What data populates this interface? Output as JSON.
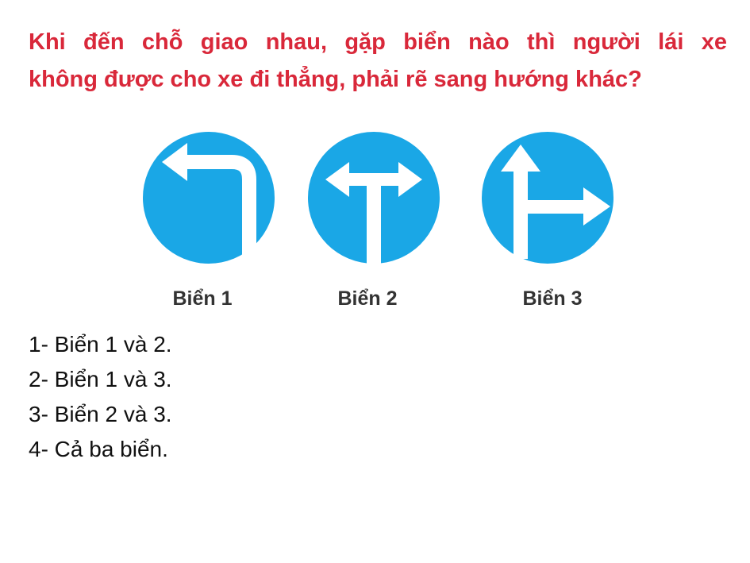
{
  "question": {
    "line1": "Khi đến chỗ giao nhau, gặp biển nào thì người lái xe",
    "line2": "không được cho xe đi thẳng, phải rẽ sang hướng khác?"
  },
  "signs": [
    {
      "label": "Biển 1",
      "icon": "turn-left-only-sign-icon"
    },
    {
      "label": "Biển 2",
      "icon": "turn-left-or-right-sign-icon"
    },
    {
      "label": "Biển 3",
      "icon": "straight-or-right-sign-icon"
    }
  ],
  "answers": [
    "1- Biển 1 và 2.",
    "2- Biển 1 và 3.",
    "3- Biển 2 và 3.",
    "4- Cả ba biển."
  ],
  "colors": {
    "question": "#d9283a",
    "sign_blue": "#1aa7e6",
    "arrow": "#ffffff"
  }
}
